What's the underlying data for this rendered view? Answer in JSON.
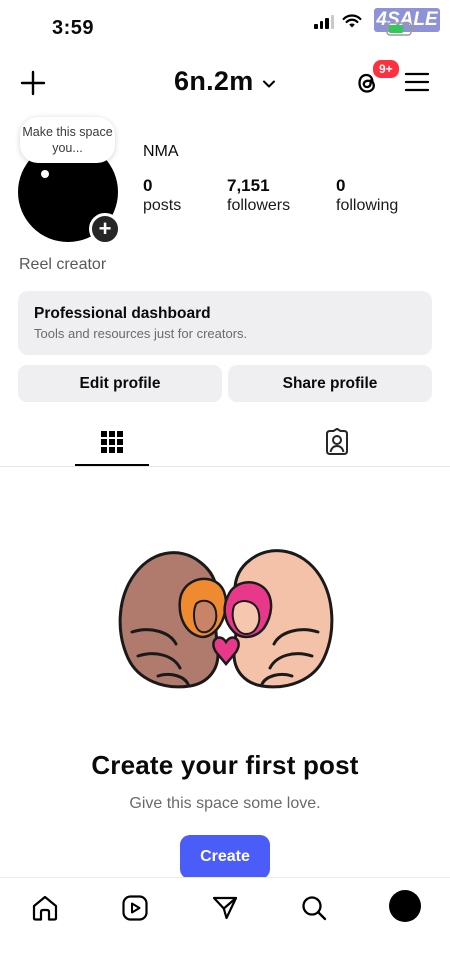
{
  "status_bar": {
    "time": "3:59",
    "watermark": "4SALE"
  },
  "topbar": {
    "username": "6n.2m",
    "threads_badge": "9+"
  },
  "profile": {
    "note_text": "Make this space you...",
    "display_name": "NMA",
    "stats": [
      {
        "value": "0",
        "label": "posts"
      },
      {
        "value": "7,151",
        "label": "followers"
      },
      {
        "value": "0",
        "label": "following"
      }
    ],
    "bio": "Reel creator"
  },
  "dashboard": {
    "title": "Professional dashboard",
    "subtitle": "Tools and resources just for creators."
  },
  "buttons": {
    "edit_profile": "Edit profile",
    "share_profile": "Share profile"
  },
  "empty_state": {
    "title": "Create your first post",
    "subtitle": "Give this space some love.",
    "cta": "Create"
  },
  "colors": {
    "accent": "#4a5df9",
    "badge": "#ff3040",
    "button_bg": "#efeff1"
  }
}
